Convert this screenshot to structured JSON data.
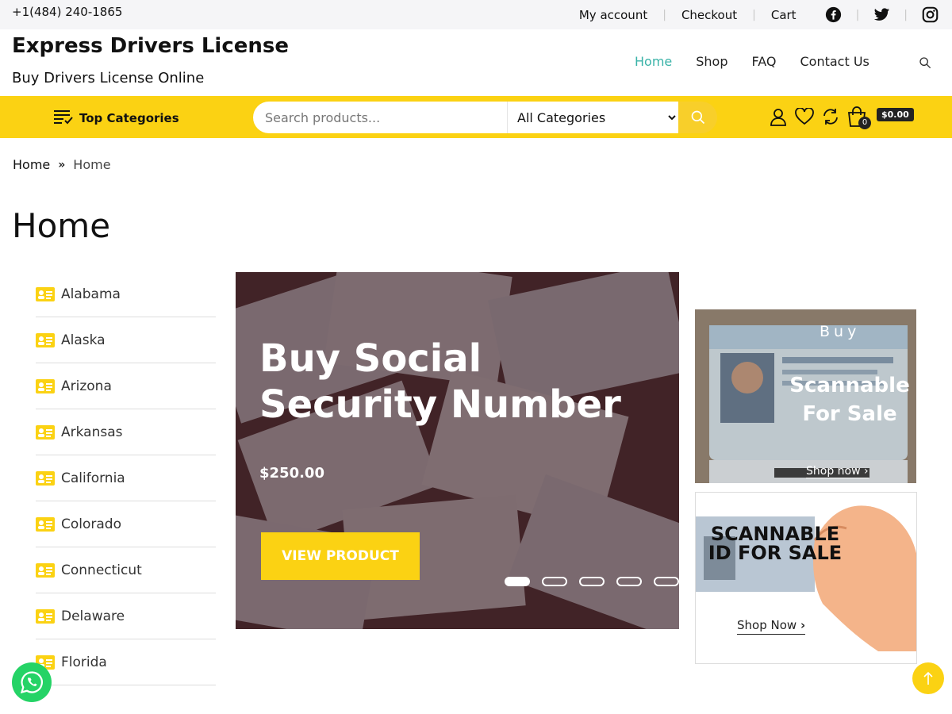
{
  "topbar": {
    "phone": "+1(484) 240-1865",
    "links": [
      "My account",
      "Checkout",
      "Cart"
    ],
    "social": [
      "facebook-icon",
      "twitter-icon",
      "instagram-icon"
    ]
  },
  "header": {
    "site_title": "Express Drivers License",
    "tagline": "Buy Drivers License Online",
    "nav": [
      "Home",
      "Shop",
      "FAQ",
      "Contact Us"
    ],
    "active_nav": "Home"
  },
  "searchbar": {
    "top_categories_label": "Top Categories",
    "placeholder": "Search products...",
    "category_selected": "All Categories",
    "cart_count": "0",
    "cart_total": "$0.00"
  },
  "breadcrumb": {
    "home": "Home",
    "current": "Home"
  },
  "page_title": "Home",
  "sidebar": {
    "items": [
      "Alabama",
      "Alaska",
      "Arizona",
      "Arkansas",
      "California",
      "Colorado",
      "Connecticut",
      "Delaware",
      "Florida"
    ]
  },
  "slider": {
    "title": "Buy Social Security Number",
    "price": "$250.00",
    "button": "VIEW PRODUCT",
    "slide_count": 5,
    "active_slide": 1
  },
  "banner1": {
    "buy": "Buy",
    "title": "Scannable For Sale",
    "shop": "Shop now"
  },
  "banner2": {
    "title": "SCANNABLE ID FOR SALE",
    "shop": "Shop Now"
  },
  "colors": {
    "accent_yellow": "#fbd213",
    "active_nav": "#3ab3a8",
    "whatsapp": "#25d366"
  }
}
